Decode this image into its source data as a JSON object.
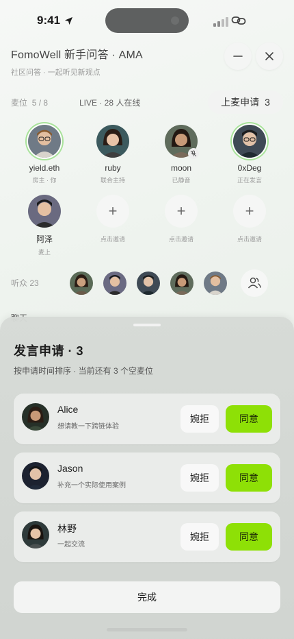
{
  "status_bar": {
    "time": "9:41"
  },
  "header": {
    "title": "FomoWell 新手问答 · AMA",
    "subtitle": "社区问答 · 一起听见新观点"
  },
  "room": {
    "seats_label": "麦位",
    "seats_count": "5 / 8",
    "live_label": "LIVE · 28 人在线",
    "apply_label": "上麦申请",
    "apply_count": "3"
  },
  "seats": [
    {
      "name": "yield.eth",
      "role": "房主 · 你",
      "speaking": true
    },
    {
      "name": "ruby",
      "role": "联合主持",
      "speaking": false
    },
    {
      "name": "moon",
      "role": "已静音",
      "speaking": false,
      "muted": true
    },
    {
      "name": "0xDeg",
      "role": "正在发言",
      "speaking": true
    },
    {
      "name": "阿泽",
      "role": "麦上",
      "speaking": false
    }
  ],
  "empty_seats": [
    {
      "role": "点击邀请"
    },
    {
      "role": "点击邀请"
    },
    {
      "role": "点击邀请"
    }
  ],
  "audience": {
    "label": "听众 23",
    "peek_text": "聊天"
  },
  "sheet": {
    "title": "发言申请 · 3",
    "subtitle": "按申请时间排序 · 当前还有 3 个空麦位",
    "requests": [
      {
        "name": "Alice",
        "note": "想请教一下跨链体验"
      },
      {
        "name": "Jason",
        "note": "补充一个实际使用案例"
      },
      {
        "name": "林野",
        "note": "一起交流"
      }
    ],
    "reject_label": "婉拒",
    "agree_label": "同意",
    "done_label": "完成"
  },
  "colors": {
    "accent_green": "#8ee006",
    "speaking_ring": "#a8e29a"
  }
}
